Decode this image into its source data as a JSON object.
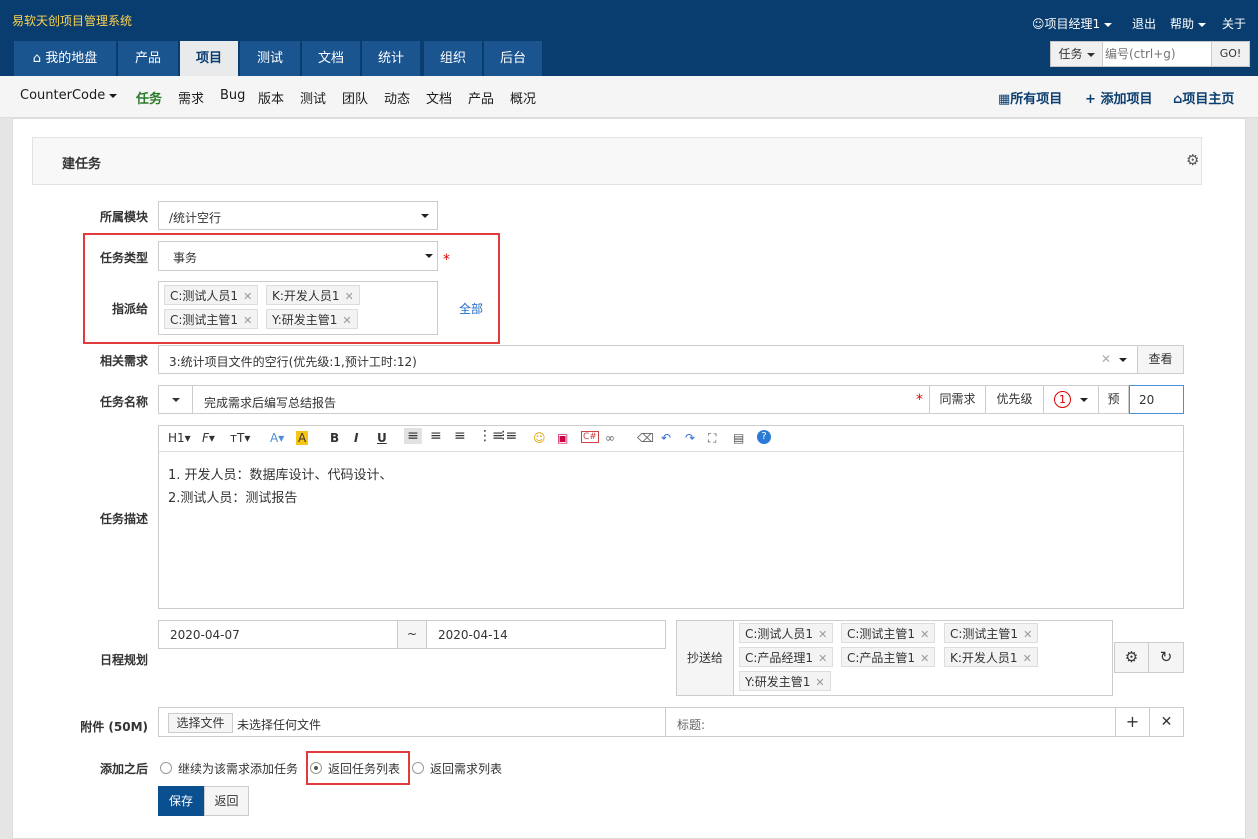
{
  "header": {
    "app_title": "易软天创项目管理系统",
    "user": "项目经理1",
    "logout": "退出",
    "help": "帮助",
    "about": "关于",
    "search": {
      "type": "任务",
      "placeholder": "编号(ctrl+g)",
      "go": "GO!"
    },
    "tabs": [
      {
        "label": "我的地盘"
      },
      {
        "label": "产品"
      },
      {
        "label": "项目"
      },
      {
        "label": "测试"
      },
      {
        "label": "文档"
      },
      {
        "label": "统计"
      },
      {
        "label": "组织"
      },
      {
        "label": "后台"
      }
    ]
  },
  "subnav": {
    "project": "CounterCode",
    "items": [
      "任务",
      "需求",
      "Bug",
      "版本",
      "测试",
      "团队",
      "动态",
      "文档",
      "产品",
      "概况"
    ],
    "right": {
      "all_projects": "所有项目",
      "add_project": "添加项目",
      "project_home": "项目主页"
    }
  },
  "form": {
    "title": "建任务",
    "module": {
      "label": "所属模块",
      "value": "/统计空行"
    },
    "type": {
      "label": "任务类型",
      "value": "事务",
      "required": "*"
    },
    "assign": {
      "label": "指派给",
      "chips": [
        "C:测试人员1",
        "K:开发人员1",
        "C:测试主管1",
        "Y:研发主管1"
      ],
      "all": "全部"
    },
    "story": {
      "label": "相关需求",
      "value": "3:统计项目文件的空行(优先级:1,预计工时:12)",
      "view": "查看"
    },
    "name": {
      "label": "任务名称",
      "value": "完成需求后编写总结报告",
      "required": "*",
      "same_story": "同需求",
      "priority_label": "优先级",
      "priority": "1",
      "estimate_label": "预",
      "estimate": "20"
    },
    "desc": {
      "label": "任务描述",
      "lines": [
        "1. 开发人员：数据库设计、代码设计、",
        "2.测试人员：测试报告"
      ],
      "toolbar": {
        "h1": "H1",
        "font": "F",
        "size": "тT",
        "bold": "B",
        "italic": "I",
        "underline": "U"
      }
    },
    "schedule": {
      "label": "日程规划",
      "start": "2020-04-07",
      "sep": "~",
      "end": "2020-04-14"
    },
    "cc": {
      "label": "抄送给",
      "chips": [
        "C:测试人员1",
        "C:测试主管1",
        "C:测试主管1",
        "C:产品经理1",
        "C:产品主管1",
        "K:开发人员1",
        "Y:研发主管1"
      ]
    },
    "files": {
      "label": "附件 (50M)",
      "choose": "选择文件",
      "none": "未选择任何文件",
      "title_label": "标题:"
    },
    "after": {
      "label": "添加之后",
      "options": [
        "继续为该需求添加任务",
        "返回任务列表",
        "返回需求列表"
      ],
      "selected": 1
    },
    "save": "保存",
    "back": "返回"
  },
  "colors": {
    "header": "#0a3d6f",
    "tab": "#1b5590",
    "highlight": "#e23b3b",
    "save": "#0a4f8f"
  }
}
